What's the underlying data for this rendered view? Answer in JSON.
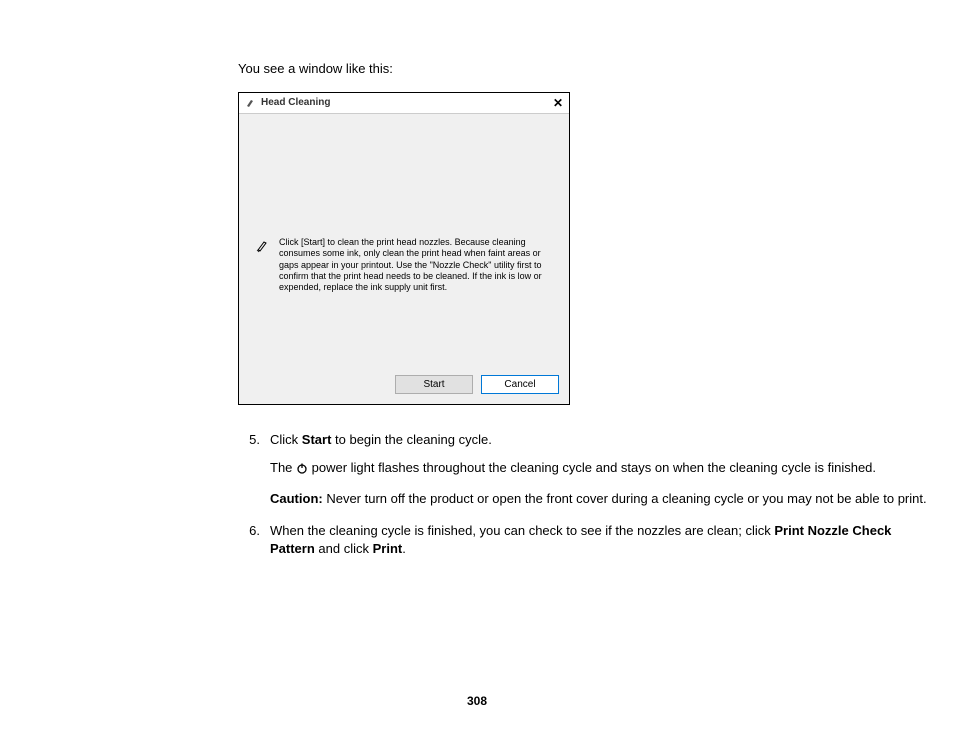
{
  "intro": "You see a window like this:",
  "dialog": {
    "title": "Head Cleaning",
    "body_text": "Click [Start] to clean the print head nozzles. Because cleaning consumes some ink, only clean the print head when faint areas or gaps appear in your printout. Use the \"Nozzle Check\" utility first to confirm that the print head needs to be cleaned. If the ink is low or expended, replace the ink supply unit first.",
    "start_label": "Start",
    "cancel_label": "Cancel"
  },
  "steps": {
    "step5": {
      "number": "5.",
      "line1_pre": "Click ",
      "line1_bold": "Start",
      "line1_post": " to begin the cleaning cycle.",
      "line2_pre": "The ",
      "line2_post": " power light flashes throughout the cleaning cycle and stays on when the cleaning cycle is finished.",
      "caution_label": "Caution:",
      "caution_text": " Never turn off the product or open the front cover during a cleaning cycle or you may not be able to print."
    },
    "step6": {
      "number": "6.",
      "pre": "When the cleaning cycle is finished, you can check to see if the nozzles are clean; click ",
      "bold1": "Print Nozzle Check Pattern",
      "mid": " and click ",
      "bold2": "Print",
      "post": "."
    }
  },
  "page_number": "308"
}
